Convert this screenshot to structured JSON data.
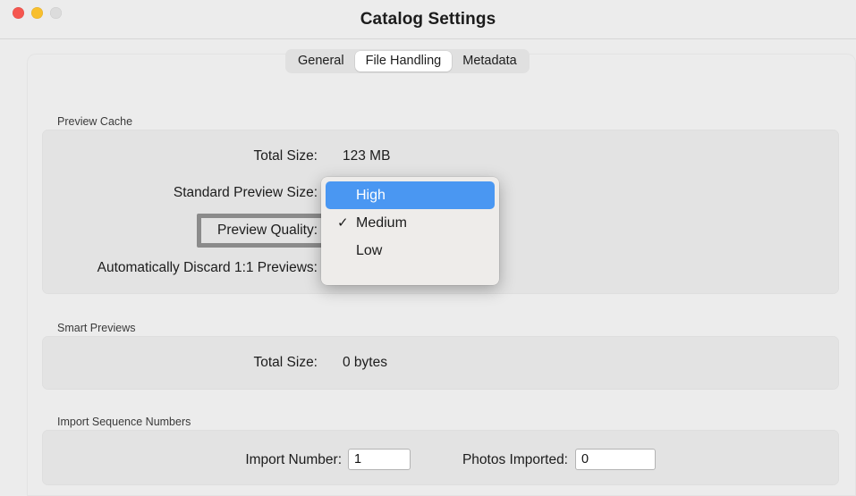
{
  "window": {
    "title": "Catalog Settings",
    "traffic_lights": [
      "close",
      "minimize",
      "zoom"
    ]
  },
  "tabs": [
    {
      "label": "General",
      "active": false
    },
    {
      "label": "File Handling",
      "active": true
    },
    {
      "label": "Metadata",
      "active": false
    }
  ],
  "sections": {
    "preview_cache": {
      "label": "Preview Cache",
      "rows": {
        "total_size": {
          "label": "Total Size:",
          "value": "123 MB"
        },
        "standard_preview_size": {
          "label": "Standard Preview Size:"
        },
        "preview_quality": {
          "label": "Preview Quality:"
        },
        "auto_discard": {
          "label": "Automatically Discard 1:1 Previews:"
        }
      }
    },
    "smart_previews": {
      "label": "Smart Previews",
      "rows": {
        "total_size": {
          "label": "Total Size:",
          "value": "0 bytes"
        }
      }
    },
    "import_sequence": {
      "label": "Import Sequence Numbers",
      "rows": {
        "import_number": {
          "label": "Import Number:",
          "value": "1"
        },
        "photos_imported": {
          "label": "Photos Imported:",
          "value": "0"
        }
      }
    }
  },
  "dropdown": {
    "name": "preview-quality-dropdown",
    "open": true,
    "selected": "Medium",
    "highlighted": "High",
    "items": [
      {
        "label": "High",
        "checked": false,
        "highlighted": true
      },
      {
        "label": "Medium",
        "checked": true,
        "highlighted": false
      },
      {
        "label": "Low",
        "checked": false,
        "highlighted": false
      }
    ],
    "checkmark_glyph": "✓"
  },
  "popup_buttons": {
    "chevron_glyph": "▾"
  },
  "colors": {
    "accent_blue": "#2f86f0",
    "menu_highlight": "#4a97f2",
    "window_bg": "#ececec",
    "group_bg": "#e3e3e3",
    "highlight_outline": "#8b8b8b"
  }
}
